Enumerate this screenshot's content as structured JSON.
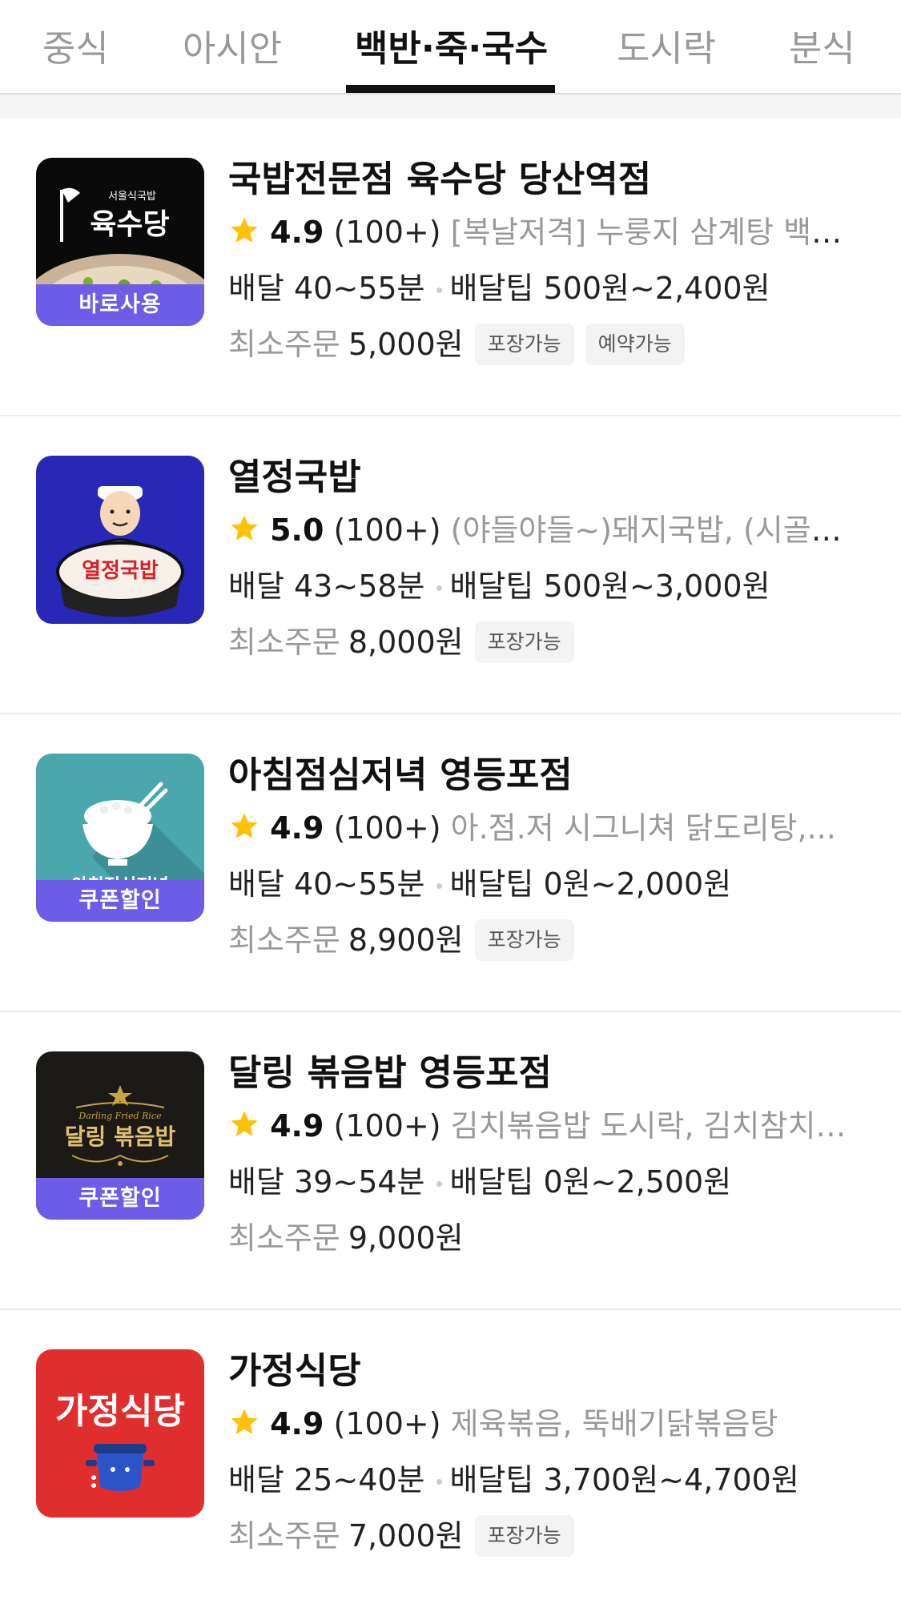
{
  "tabs": [
    {
      "label": "중식"
    },
    {
      "label": "아시안"
    },
    {
      "label": "백반·죽·국수"
    },
    {
      "label": "도시락"
    },
    {
      "label": "분식"
    }
  ],
  "active_tab": "백반·죽·국수",
  "colors": {
    "badge_purple": "#6c5ce7",
    "star_yellow": "#ffc107",
    "muted_text": "#999999"
  },
  "stores": [
    {
      "name": "국밥전문점 육수당 당산역점",
      "rating": "4.9",
      "reviews": "(100+)",
      "menu": "[복날저격] 누룽지 삼계탕 백숙...",
      "delivery": "배달 40~55분",
      "tip": "배달팁 500원~2,400원",
      "min_label": "최소주문",
      "min_value": "5,000원",
      "chips": [
        "포장가능",
        "예약가능"
      ],
      "badge": "바로사용",
      "logo": {
        "small": "서울식국밥",
        "big": "육수당"
      }
    },
    {
      "name": "열정국밥",
      "rating": "5.0",
      "reviews": "(100+)",
      "menu": "(야들야들~)돼지국밥, (시골순…",
      "delivery": "배달 43~58분",
      "tip": "배달팁 500원~3,000원",
      "min_label": "최소주문",
      "min_value": "8,000원",
      "chips": [
        "포장가능"
      ],
      "badge": "",
      "logo": {
        "big": "열정국밥"
      }
    },
    {
      "name": "아침점심저녁 영등포점",
      "rating": "4.9",
      "reviews": "(100+)",
      "menu": "아.점.저 시그니쳐 닭도리탕,...",
      "delivery": "배달 40~55분",
      "tip": "배달팁 0원~2,000원",
      "min_label": "최소주문",
      "min_value": "8,900원",
      "chips": [
        "포장가능"
      ],
      "badge": "쿠폰할인",
      "logo": {
        "big": "아침점심저녁"
      }
    },
    {
      "name": "달링 볶음밥 영등포점",
      "rating": "4.9",
      "reviews": "(100+)",
      "menu": "김치볶음밥 도시락, 김치참치…",
      "delivery": "배달 39~54분",
      "tip": "배달팁 0원~2,500원",
      "min_label": "최소주문",
      "min_value": "9,000원",
      "chips": [],
      "badge": "쿠폰할인",
      "logo": {
        "small": "Darling Fried Rice",
        "big": "달링 볶음밥"
      }
    },
    {
      "name": "가정식당",
      "rating": "4.9",
      "reviews": "(100+)",
      "menu": "제육볶음, 뚝배기닭볶음탕",
      "delivery": "배달 25~40분",
      "tip": "배달팁 3,700원~4,700원",
      "min_label": "최소주문",
      "min_value": "7,000원",
      "chips": [
        "포장가능"
      ],
      "badge": "",
      "logo": {
        "big": "가정식당"
      }
    }
  ]
}
